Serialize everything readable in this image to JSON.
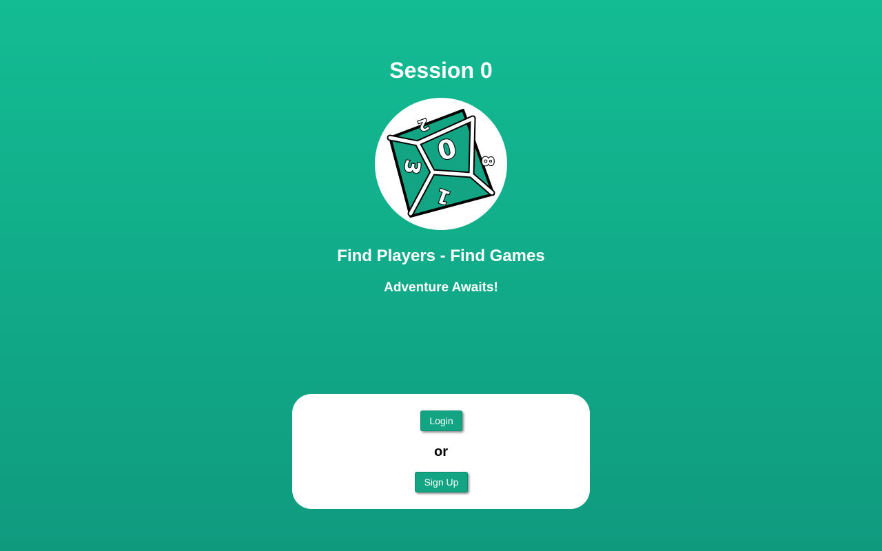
{
  "app": {
    "title": "Session 0",
    "tagline": "Find Players - Find Games",
    "subtagline": "Adventure Awaits!"
  },
  "logo": {
    "icon": "d10-dice-icon",
    "faces": [
      "0",
      "3",
      "1",
      "8",
      "2"
    ]
  },
  "auth": {
    "login_label": "Login",
    "or_label": "or",
    "signup_label": "Sign Up"
  },
  "colors": {
    "background_top": "#13bc93",
    "background_bottom": "#0f9a7e",
    "button": "#13a583",
    "dice_face": "#13a583"
  }
}
